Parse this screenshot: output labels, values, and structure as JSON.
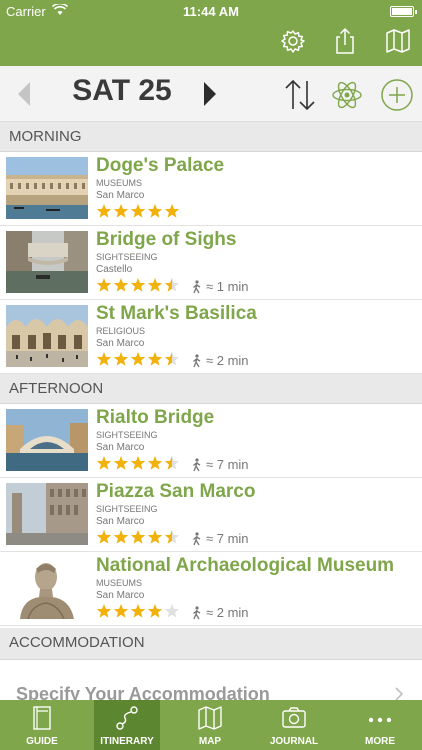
{
  "status": {
    "carrier": "Carrier",
    "time": "11:44 AM"
  },
  "header": {
    "icons": [
      "gear-icon",
      "share-icon",
      "map-icon"
    ]
  },
  "daynav": {
    "day": "SAT 25"
  },
  "sections": {
    "morning": "MORNING",
    "afternoon": "AFTERNOON",
    "accommodation": "ACCOMMODATION"
  },
  "morning": [
    {
      "title": "Doge's Palace",
      "category": "MUSEUMS",
      "area": "San Marco",
      "rating": 5,
      "walk": ""
    },
    {
      "title": "Bridge of Sighs",
      "category": "SIGHTSEEING",
      "area": "Castello",
      "rating": 4.5,
      "walk": "≈ 1 min"
    },
    {
      "title": "St Mark's Basilica",
      "category": "RELIGIOUS",
      "area": "San Marco",
      "rating": 4.5,
      "walk": "≈ 2 min"
    }
  ],
  "afternoon": [
    {
      "title": "Rialto Bridge",
      "category": "SIGHTSEEING",
      "area": "San Marco",
      "rating": 4.5,
      "walk": "≈ 7 min"
    },
    {
      "title": "Piazza San Marco",
      "category": "SIGHTSEEING",
      "area": "San Marco",
      "rating": 4.5,
      "walk": "≈ 7 min"
    },
    {
      "title": "National Archaeological Museum",
      "category": "MUSEUMS",
      "area": "San Marco",
      "rating": 4,
      "walk": "≈ 2 min"
    }
  ],
  "accommodation": {
    "label": "Specify Your Accommodation"
  },
  "tabs": [
    {
      "label": "GUIDE",
      "icon": "book-icon"
    },
    {
      "label": "ITINERARY",
      "icon": "route-icon",
      "active": true
    },
    {
      "label": "MAP",
      "icon": "map-icon"
    },
    {
      "label": "JOURNAL",
      "icon": "camera-icon"
    },
    {
      "label": "MORE",
      "icon": "more-icon"
    }
  ],
  "colors": {
    "brand_green": "#7fa64a",
    "active_tab": "#5d8631",
    "star": "#f2b20c"
  }
}
